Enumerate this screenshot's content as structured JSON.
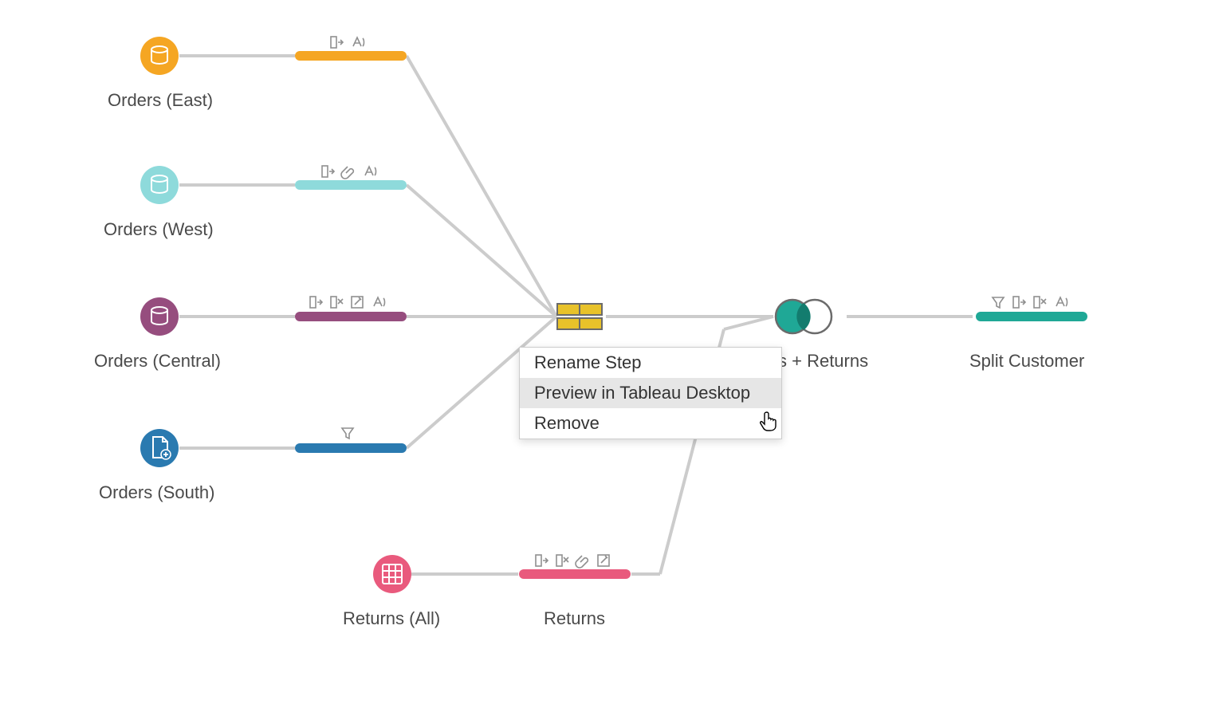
{
  "colors": {
    "gray_line": "#cccccc",
    "orange": "#f5a623",
    "teal_light": "#8edadb",
    "plum": "#964d7e",
    "blue_dark": "#2a7ab0",
    "pink": "#e95a7d",
    "teal": "#1fa896",
    "union_yellow": "#e8c22a",
    "icon_gray": "#8f8f8f",
    "text": "#4a4a4a"
  },
  "labels": {
    "orders_east": "Orders (East)",
    "orders_west": "Orders (West)",
    "orders_central": "Orders (Central)",
    "orders_south": "Orders (South)",
    "returns_all": "Returns (All)",
    "returns": "Returns",
    "orders_returns_suffix": "s + Returns",
    "split_customer": "Split Customer"
  },
  "menu": {
    "rename": "Rename Step",
    "preview": "Preview in Tableau Desktop",
    "remove": "Remove"
  },
  "icon_names": {
    "col_out": "col-out-icon",
    "col_del": "col-del-icon",
    "edit": "edit-icon",
    "rename": "rename-text-icon",
    "clip": "paperclip-icon",
    "filter": "filter-icon"
  }
}
